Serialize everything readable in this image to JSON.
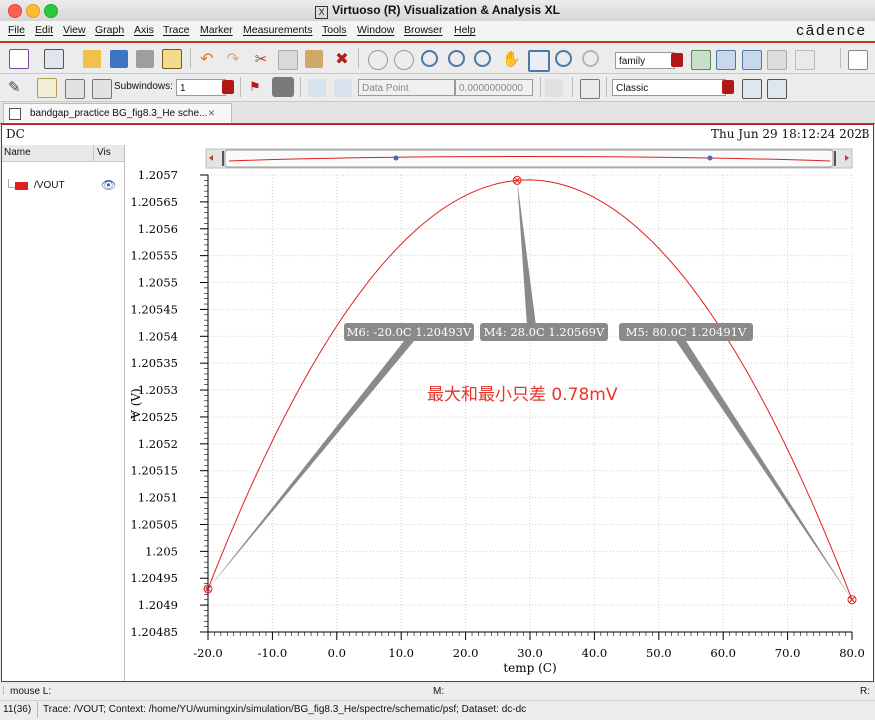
{
  "window": {
    "title": "Virtuoso (R) Visualization & Analysis XL",
    "brand": "cādence"
  },
  "menu": [
    "File",
    "Edit",
    "View",
    "Graph",
    "Axis",
    "Trace",
    "Marker",
    "Measurements",
    "Tools",
    "Window",
    "Browser",
    "Help"
  ],
  "toolbar": {
    "family_value": "family",
    "subwindows_label": "Subwindows:",
    "subwindows_value": "1",
    "data_point_value": "Data Point",
    "coord_value": "0.0000000000",
    "style_value": "Classic"
  },
  "tab": {
    "label": "bandgap_practice BG_fig8.3_He sche...",
    "close": "×"
  },
  "plot": {
    "analysis": "DC",
    "timestamp": "Thu Jun 29 18:12:24 2023",
    "subwindow_number": "1",
    "sidebar_headers": {
      "name": "Name",
      "vis": "Vis"
    },
    "trace_name": "/VOUT",
    "annotation": "最大和最小只差 0.78mV"
  },
  "chart_data": {
    "type": "line",
    "xlabel": "temp (C)",
    "ylabel": "V (V)",
    "xlim": [
      -20,
      80
    ],
    "ylim": [
      1.20485,
      1.2057
    ],
    "x_ticks": [
      "-20.0",
      "-10.0",
      "0.0",
      "10.0",
      "20.0",
      "30.0",
      "40.0",
      "50.0",
      "60.0",
      "70.0",
      "80.0"
    ],
    "y_ticks": [
      "1.2057",
      "1.20565",
      "1.2056",
      "1.20555",
      "1.2055",
      "1.20545",
      "1.2054",
      "1.20535",
      "1.2053",
      "1.20525",
      "1.2052",
      "1.20515",
      "1.2051",
      "1.20505",
      "1.205",
      "1.20495",
      "1.2049",
      "1.20485"
    ],
    "grid": true,
    "series": [
      {
        "name": "/VOUT",
        "color": "#e02020",
        "x": [
          -20,
          -10,
          0,
          10,
          20,
          28,
          40,
          50,
          60,
          70,
          80
        ],
        "y": [
          1.20493,
          1.20522,
          1.20543,
          1.20558,
          1.20567,
          1.20569,
          1.20564,
          1.20552,
          1.20536,
          1.20515,
          1.20491
        ]
      }
    ],
    "markers": [
      {
        "label": "M6: -20.0C 1.20493V",
        "x": -20,
        "y": 1.20493
      },
      {
        "label": "M4: 28.0C 1.20569V",
        "x": 28,
        "y": 1.20569
      },
      {
        "label": "M5: 80.0C 1.20491V",
        "x": 80,
        "y": 1.20491
      }
    ]
  },
  "status": {
    "mouse_l": "mouse L:",
    "mouse_m": "M:",
    "mouse_r": "R:",
    "counter": "11(36)",
    "message": "Trace: /VOUT; Context: /home/YU/wumingxin/simulation/BG_fig8.3_He/spectre/schematic/psf; Dataset: dc-dc"
  },
  "colors": {
    "accent": "#c0392b",
    "trace": "#e02020",
    "annotation": "#e8352a"
  }
}
